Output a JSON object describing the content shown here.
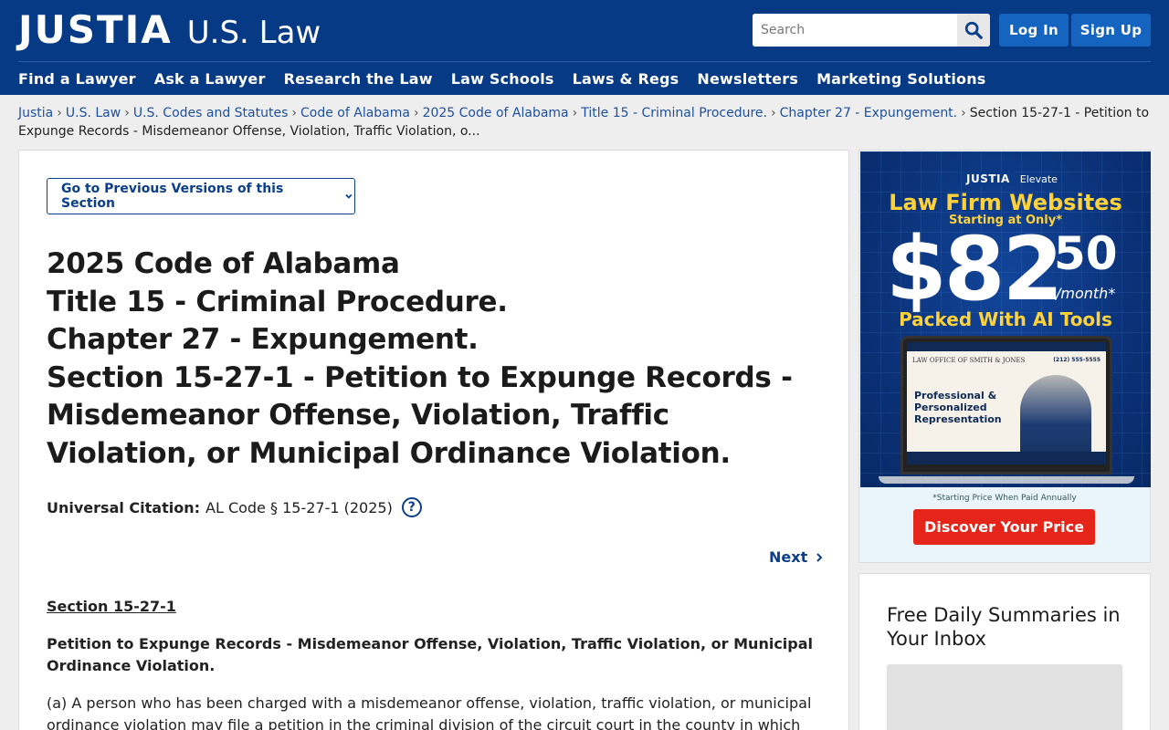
{
  "header": {
    "brand": "JUSTIA",
    "sub": "U.S. Law",
    "search_placeholder": "Search",
    "login_label": "Log In",
    "signup_label": "Sign Up",
    "accent": "#063a84",
    "button_color": "#1565c0"
  },
  "nav": [
    "Find a Lawyer",
    "Ask a Lawyer",
    "Research the Law",
    "Law Schools",
    "Laws & Regs",
    "Newsletters",
    "Marketing Solutions"
  ],
  "breadcrumb": {
    "links": [
      "Justia",
      "U.S. Law",
      "U.S. Codes and Statutes",
      "Code of Alabama",
      "2025 Code of Alabama",
      "Title 15 - Criminal Procedure.",
      "Chapter 27 - Expungement."
    ],
    "current": "Section 15-27-1 - Petition to Expunge Records - Misdemeanor Offense, Violation, Traffic Violation, o..."
  },
  "main": {
    "prev_versions_label": "Go to Previous Versions of this Section",
    "title_lines": [
      "2025 Code of Alabama",
      "Title 15 - Criminal Procedure.",
      "Chapter 27 - Expungement.",
      "Section 15-27-1 - Petition to Expunge Records - Misdemeanor Offense, Violation, Traffic Violation, or Municipal Ordinance Violation."
    ],
    "citation_label": "Universal Citation:",
    "citation_value": "AL Code § 15-27-1 (2025)",
    "help_icon": "?",
    "next_label": "Next",
    "section_heading": "Section 15-27-1",
    "section_title": "Petition to Expunge Records - Misdemeanor Offense, Violation, Traffic Violation, or Municipal Ordinance Violation.",
    "paragraph_a": "(a) A person who has been charged with a misdemeanor offense, violation, traffic violation, or municipal ordinance violation may file a petition in the criminal division of the circuit court in the county in which the"
  },
  "ad": {
    "brand": "JUSTIA",
    "brand_sub": "Elevate",
    "headline": "Law Firm Websites",
    "starting": "Starting at Only*",
    "price": "$82",
    "cents": "50",
    "per": "/month*",
    "packed": "Packed With AI Tools",
    "screen_firm": "LAW OFFICE OF SMITH & JONES",
    "screen_phone": "(212) 555-5555",
    "screen_tagline": "Professional & Personalized Representation",
    "note": "*Starting Price When Paid Annually",
    "cta": "Discover Your Price"
  },
  "newsletter": {
    "title": "Free Daily Summaries in Your Inbox"
  }
}
